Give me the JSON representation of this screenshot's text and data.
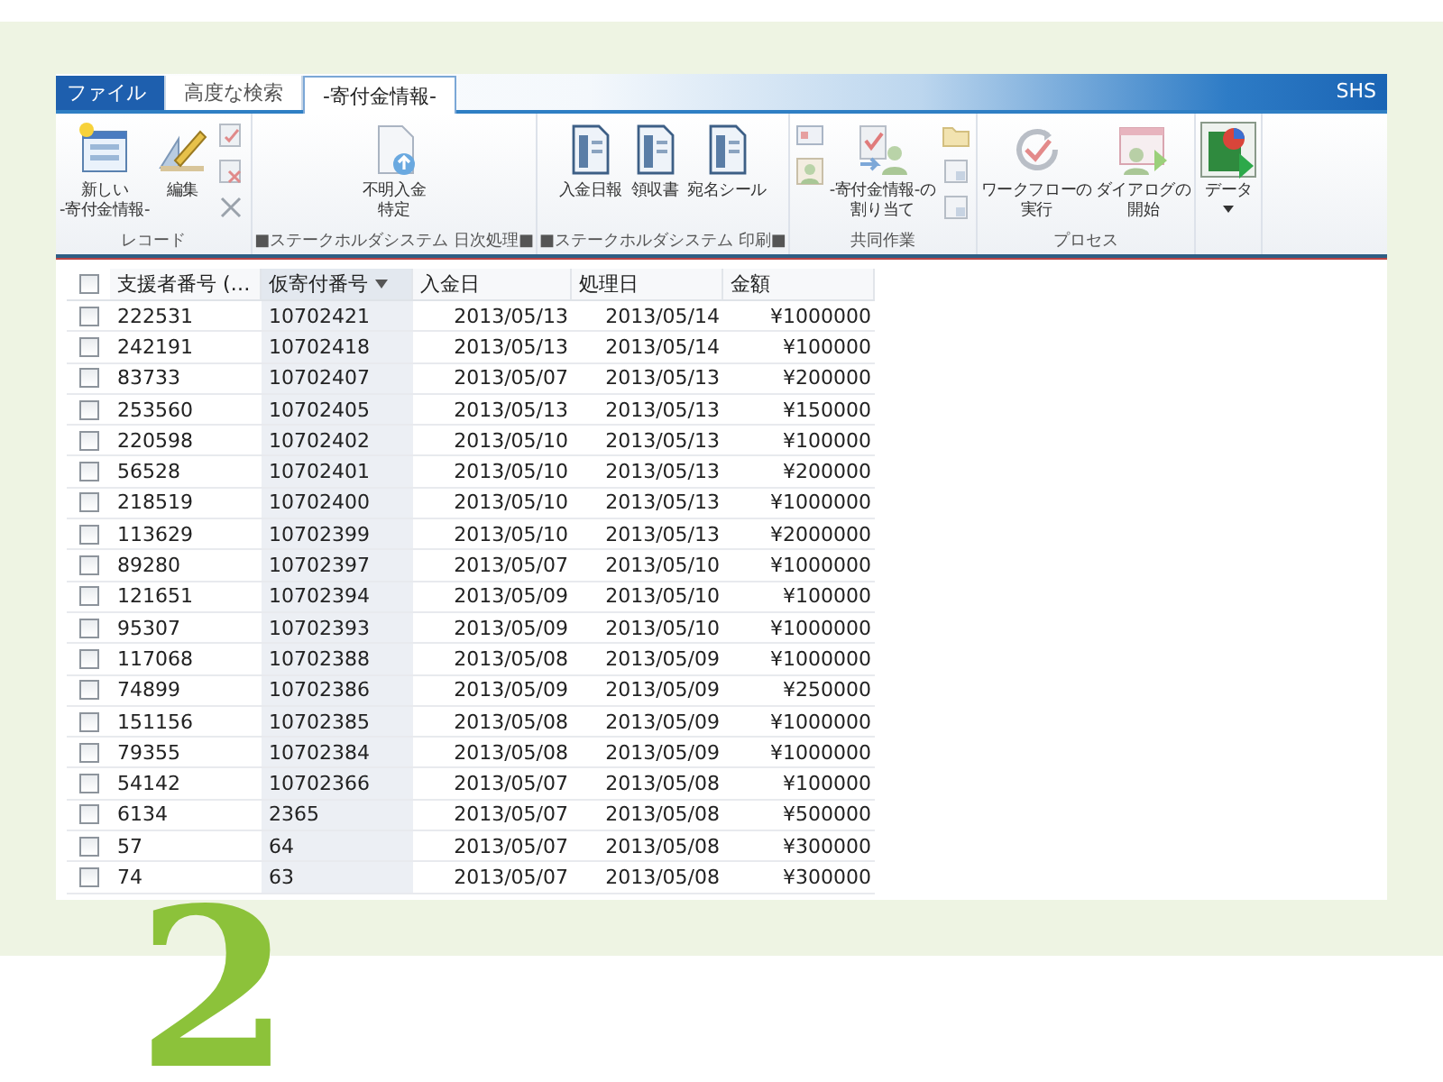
{
  "tabs": [
    {
      "label": "ファイル",
      "kind": "file",
      "selected": false
    },
    {
      "label": "高度な検索",
      "kind": "tab",
      "selected": false
    },
    {
      "label": "-寄付金情報-",
      "kind": "tab",
      "selected": true
    }
  ],
  "user": "SHS",
  "ribbon_groups": [
    {
      "label": "レコード",
      "items": [
        {
          "kind": "large",
          "label": [
            "新しい",
            "-寄付金情報-"
          ]
        },
        {
          "kind": "large",
          "label": [
            "編集"
          ]
        },
        {
          "kind": "stack"
        }
      ]
    },
    {
      "label": "■ステークホルダシステム 日次処理■",
      "items": [
        {
          "kind": "large",
          "label": [
            "不明入金",
            "特定"
          ]
        }
      ]
    },
    {
      "label": "■ステークホルダシステム 印刷■",
      "items": [
        {
          "kind": "large",
          "label": [
            "入金日報"
          ]
        },
        {
          "kind": "large",
          "label": [
            "領収書"
          ]
        },
        {
          "kind": "large",
          "label": [
            "宛名シール"
          ]
        }
      ]
    },
    {
      "label": "共同作業",
      "items": [
        {
          "kind": "stack"
        },
        {
          "kind": "large",
          "label": [
            "-寄付金情報-の",
            "割り当て"
          ]
        },
        {
          "kind": "stack"
        }
      ]
    },
    {
      "label": "プロセス",
      "items": [
        {
          "kind": "large",
          "label": [
            "ワークフローの",
            "実行"
          ]
        },
        {
          "kind": "large",
          "label": [
            "ダイアログの",
            "開始"
          ]
        }
      ]
    },
    {
      "items": [
        {
          "kind": "large",
          "label": [
            "データ"
          ],
          "dropdown": true
        }
      ]
    }
  ],
  "table": {
    "select_all": {
      "checked": false
    },
    "columns": [
      {
        "label": "支援者番号 (…",
        "sorted": false
      },
      {
        "label": "仮寄付番号",
        "sorted": true
      },
      {
        "label": "入金日",
        "sorted": false
      },
      {
        "label": "処理日",
        "sorted": false
      },
      {
        "label": "金額",
        "sorted": false
      }
    ],
    "rows": [
      {
        "checked": false,
        "cells": [
          "222531",
          "10702421",
          "2013/05/13",
          "2013/05/14",
          "¥1000000"
        ]
      },
      {
        "checked": false,
        "cells": [
          "242191",
          "10702418",
          "2013/05/13",
          "2013/05/14",
          "¥100000"
        ]
      },
      {
        "checked": false,
        "cells": [
          "83733",
          "10702407",
          "2013/05/07",
          "2013/05/13",
          "¥200000"
        ]
      },
      {
        "checked": false,
        "cells": [
          "253560",
          "10702405",
          "2013/05/13",
          "2013/05/13",
          "¥150000"
        ]
      },
      {
        "checked": false,
        "cells": [
          "220598",
          "10702402",
          "2013/05/10",
          "2013/05/13",
          "¥100000"
        ]
      },
      {
        "checked": false,
        "cells": [
          "56528",
          "10702401",
          "2013/05/10",
          "2013/05/13",
          "¥200000"
        ]
      },
      {
        "checked": false,
        "cells": [
          "218519",
          "10702400",
          "2013/05/10",
          "2013/05/13",
          "¥1000000"
        ]
      },
      {
        "checked": false,
        "cells": [
          "113629",
          "10702399",
          "2013/05/10",
          "2013/05/13",
          "¥2000000"
        ]
      },
      {
        "checked": false,
        "cells": [
          "89280",
          "10702397",
          "2013/05/07",
          "2013/05/10",
          "¥1000000"
        ]
      },
      {
        "checked": false,
        "cells": [
          "121651",
          "10702394",
          "2013/05/09",
          "2013/05/10",
          "¥100000"
        ]
      },
      {
        "checked": false,
        "cells": [
          "95307",
          "10702393",
          "2013/05/09",
          "2013/05/10",
          "¥1000000"
        ]
      },
      {
        "checked": false,
        "cells": [
          "117068",
          "10702388",
          "2013/05/08",
          "2013/05/09",
          "¥1000000"
        ]
      },
      {
        "checked": false,
        "cells": [
          "74899",
          "10702386",
          "2013/05/09",
          "2013/05/09",
          "¥250000"
        ]
      },
      {
        "checked": false,
        "cells": [
          "151156",
          "10702385",
          "2013/05/08",
          "2013/05/09",
          "¥1000000"
        ]
      },
      {
        "checked": false,
        "cells": [
          "79355",
          "10702384",
          "2013/05/08",
          "2013/05/09",
          "¥1000000"
        ]
      },
      {
        "checked": false,
        "cells": [
          "54142",
          "10702366",
          "2013/05/07",
          "2013/05/08",
          "¥100000"
        ]
      },
      {
        "checked": false,
        "cells": [
          "6134",
          "2365",
          "2013/05/07",
          "2013/05/08",
          "¥500000"
        ]
      },
      {
        "checked": false,
        "cells": [
          "57",
          "64",
          "2013/05/07",
          "2013/05/08",
          "¥300000"
        ]
      },
      {
        "checked": false,
        "cells": [
          "74",
          "63",
          "2013/05/07",
          "2013/05/08",
          "¥300000"
        ]
      }
    ]
  },
  "step_number": "2"
}
